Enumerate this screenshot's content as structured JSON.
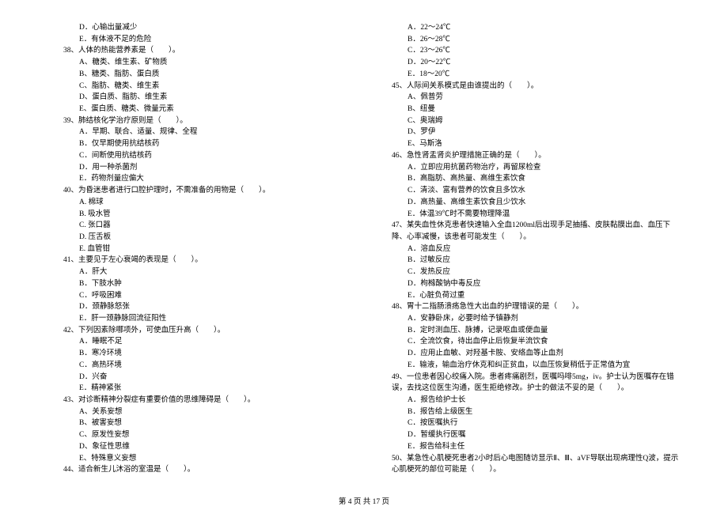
{
  "left": [
    {
      "cls": "indent1",
      "text": "D．心输出量减少"
    },
    {
      "cls": "indent1",
      "text": "E．有体液不足的危险"
    },
    {
      "cls": "q",
      "text": "38、人体的热能营养素是（　　）。"
    },
    {
      "cls": "indent1",
      "text": "A、糖类、维生素、矿物质"
    },
    {
      "cls": "indent1",
      "text": "B、糖类、脂肪、蛋白质"
    },
    {
      "cls": "indent1",
      "text": "C、脂肪、糖类、维生素"
    },
    {
      "cls": "indent1",
      "text": "D、蛋白质、脂肪、维生素"
    },
    {
      "cls": "indent1",
      "text": "E、蛋白质、糖类、微量元素"
    },
    {
      "cls": "q",
      "text": "39、肺结核化学治疗原则是（　　）。"
    },
    {
      "cls": "indent1",
      "text": "A．早期、联合、适量、规律、全程"
    },
    {
      "cls": "indent1",
      "text": "B．仅早期使用抗结核药"
    },
    {
      "cls": "indent1",
      "text": "C．间断使用抗结核药"
    },
    {
      "cls": "indent1",
      "text": "D．用一种杀菌剂"
    },
    {
      "cls": "indent1",
      "text": "E．药物剂量应偏大"
    },
    {
      "cls": "q",
      "text": "40、为昏迷患者进行口腔护理时，不需准备的用物是（　　）。"
    },
    {
      "cls": "indent1",
      "text": "A. 棉球"
    },
    {
      "cls": "indent1",
      "text": "B. 吸水管"
    },
    {
      "cls": "indent1",
      "text": "C. 张口器"
    },
    {
      "cls": "indent1",
      "text": "D. 压舌板"
    },
    {
      "cls": "indent1",
      "text": "E. 血管钳"
    },
    {
      "cls": "q",
      "text": "41、主要见于左心衰竭的表现是（　　）。"
    },
    {
      "cls": "indent1",
      "text": "A．肝大"
    },
    {
      "cls": "indent1",
      "text": "B．下肢水肿"
    },
    {
      "cls": "indent1",
      "text": "C．呼吸困难"
    },
    {
      "cls": "indent1",
      "text": "D．颈静脉怒张"
    },
    {
      "cls": "indent1",
      "text": "E．肝一颈静脉回流征阳性"
    },
    {
      "cls": "q",
      "text": "42、下列因素除哪项外，可使血压升高（　　）。"
    },
    {
      "cls": "indent1",
      "text": "A．睡眠不足"
    },
    {
      "cls": "indent1",
      "text": "B．寒冷环境"
    },
    {
      "cls": "indent1",
      "text": "C．高热环境"
    },
    {
      "cls": "indent1",
      "text": "D．兴奋"
    },
    {
      "cls": "indent1",
      "text": "E．精神紧张"
    },
    {
      "cls": "q",
      "text": "43、对诊断精神分裂症有重要价值的思维障碍是（　　）。"
    },
    {
      "cls": "indent1",
      "text": "A、关系妄想"
    },
    {
      "cls": "indent1",
      "text": "B、被害妄想"
    },
    {
      "cls": "indent1",
      "text": "C、原发性妄想"
    },
    {
      "cls": "indent1",
      "text": "D、象征性思维"
    },
    {
      "cls": "indent1",
      "text": "E、特殊意义妄想"
    },
    {
      "cls": "q",
      "text": "44、适合新生儿沐浴的室温是（　　）。"
    }
  ],
  "right": [
    {
      "cls": "indent1",
      "text": "A．22～24℃"
    },
    {
      "cls": "indent1",
      "text": "B．26～28℃"
    },
    {
      "cls": "indent1",
      "text": "C．23～26℃"
    },
    {
      "cls": "indent1",
      "text": "D．20～22℃"
    },
    {
      "cls": "indent1",
      "text": "E．18～20℃"
    },
    {
      "cls": "q",
      "text": "45、人际间关系模式是由谁提出的（　　）。"
    },
    {
      "cls": "indent1",
      "text": "A、佩普劳"
    },
    {
      "cls": "indent1",
      "text": "B、纽曼"
    },
    {
      "cls": "indent1",
      "text": "C、奥瑞姆"
    },
    {
      "cls": "indent1",
      "text": "D、罗伊"
    },
    {
      "cls": "indent1",
      "text": "E、马斯洛"
    },
    {
      "cls": "q",
      "text": "46、急性肾盂肾炎护理措施正确的是（　　）。"
    },
    {
      "cls": "indent1",
      "text": "A．立即应用抗菌药物治疗，再留尿检查"
    },
    {
      "cls": "indent1",
      "text": "B．高脂肪、高热量、高维生素饮食"
    },
    {
      "cls": "indent1",
      "text": "C．清淡、富有营养的饮食且多饮水"
    },
    {
      "cls": "indent1",
      "text": "D．高热量、高维生素饮食且少饮水"
    },
    {
      "cls": "indent1",
      "text": "E．体温39℃时不需要物理降温"
    },
    {
      "cls": "q",
      "text": "47、某失血性休克患者快速输入全血1200ml后出现手足抽搐、皮肤黏膜出血、血压下降、心率减慢，该患者可能发生（　　）。"
    },
    {
      "cls": "indent1",
      "text": "A．溶血反应"
    },
    {
      "cls": "indent1",
      "text": "B．过敏反应"
    },
    {
      "cls": "indent1",
      "text": "C．发热反应"
    },
    {
      "cls": "indent1",
      "text": "D．枸橼酸钠中毒反应"
    },
    {
      "cls": "indent1",
      "text": "E．心脏负荷过重"
    },
    {
      "cls": "q",
      "text": "48、胃十二指肠溃疡急性大出血的护理错误的是（　　）。"
    },
    {
      "cls": "indent1",
      "text": "A．安静卧床，必要时给予镇静剂"
    },
    {
      "cls": "indent1",
      "text": "B．定时测血压、脉搏，记录呕血或便血量"
    },
    {
      "cls": "indent1",
      "text": "C．全流饮食，待出血停止后恢复半流饮食"
    },
    {
      "cls": "indent1",
      "text": "D．应用止血敏、对羟基卡胺、安络血等止血剂"
    },
    {
      "cls": "indent1",
      "text": "E．输液，输血治疗休克和纠正贫血，以血压恢复稍低于正常值为宜"
    },
    {
      "cls": "q",
      "text": "49、一位患者因心绞痛入院。患者疼痛剧烈，医嘱吗啡5mg，iv。护士认为医嘱存在错误，去找这位医生沟通，医生拒绝修改。护士的做法不妥的是（　　）。"
    },
    {
      "cls": "indent1",
      "text": "A．报告给护士长"
    },
    {
      "cls": "indent1",
      "text": "B．报告给上级医生"
    },
    {
      "cls": "indent1",
      "text": "C．按医嘱执行"
    },
    {
      "cls": "indent1",
      "text": "D．暂缓执行医嘱"
    },
    {
      "cls": "indent1",
      "text": "E．报告给科主任"
    },
    {
      "cls": "q",
      "text": "50、某急性心肌梗死患者2小时后心电图随访显示Ⅱ、Ⅲ、aVF导联出现病理性Q波，提示心肌梗死的部位可能是（　　）。"
    }
  ],
  "footer": "第 4 页 共 17 页"
}
